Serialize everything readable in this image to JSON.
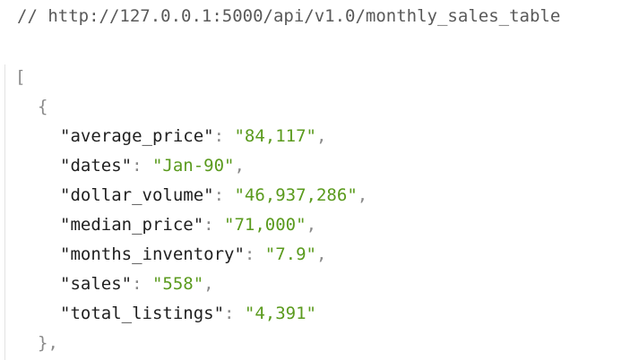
{
  "comment": "// http://127.0.0.1:5000/api/v1.0/monthly_sales_table",
  "json_view": {
    "array_open": "[",
    "object_open": "{",
    "object_close": "},",
    "colon": ": ",
    "comma": ",",
    "entries": [
      {
        "key": "\"average_price\"",
        "value": "\"84,117\""
      },
      {
        "key": "\"dates\"",
        "value": "\"Jan-90\""
      },
      {
        "key": "\"dollar_volume\"",
        "value": "\"46,937,286\""
      },
      {
        "key": "\"median_price\"",
        "value": "\"71,000\""
      },
      {
        "key": "\"months_inventory\"",
        "value": "\"7.9\""
      },
      {
        "key": "\"sales\"",
        "value": "\"558\""
      },
      {
        "key": "\"total_listings\"",
        "value": "\"4,391\""
      }
    ]
  },
  "colors": {
    "background": "#ffffff",
    "string": "#5a9a1d",
    "comment": "#595959",
    "punctuation": "#8a8a8a"
  }
}
